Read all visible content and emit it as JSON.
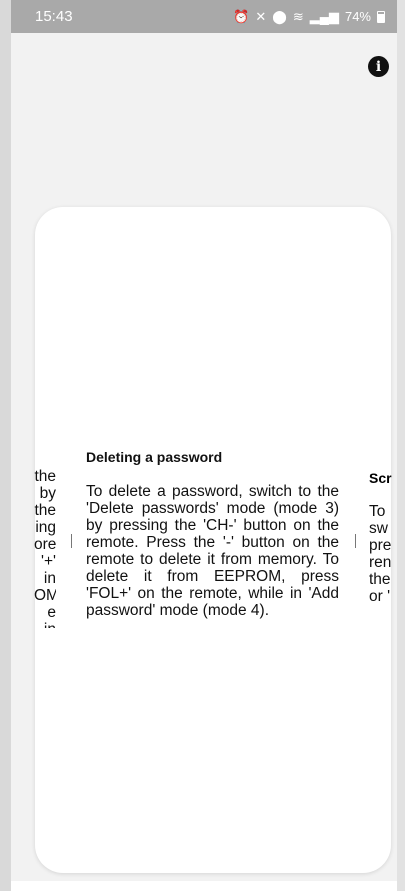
{
  "status_bar": {
    "time": "15:43",
    "icons": [
      "alarm-icon",
      "mute-icon",
      "location-icon",
      "wifi-icon",
      "signal-icon",
      "signal-icon-2"
    ],
    "battery": "74%"
  },
  "info_button": {
    "label": "i"
  },
  "slides": {
    "previous": {
      "lines": [
        "the",
        "by",
        "the",
        "ing",
        "ore.",
        "'+'",
        "in",
        "OM,",
        "e in"
      ]
    },
    "current": {
      "title": "Deleting a password",
      "body": "To delete a password, switch to the 'Delete passwords' mode (mode 3) by pressing the 'CH-' button on the remote. Press the '-' button on the remote to delete it from memory. To delete it from EEPROM, press 'FOL+' on the remote, while in 'Add password' mode (mode 4)."
    },
    "next": {
      "title": "Scr",
      "lines": [
        "To",
        "sw",
        "pre",
        "ren",
        "the",
        "or '"
      ]
    }
  }
}
